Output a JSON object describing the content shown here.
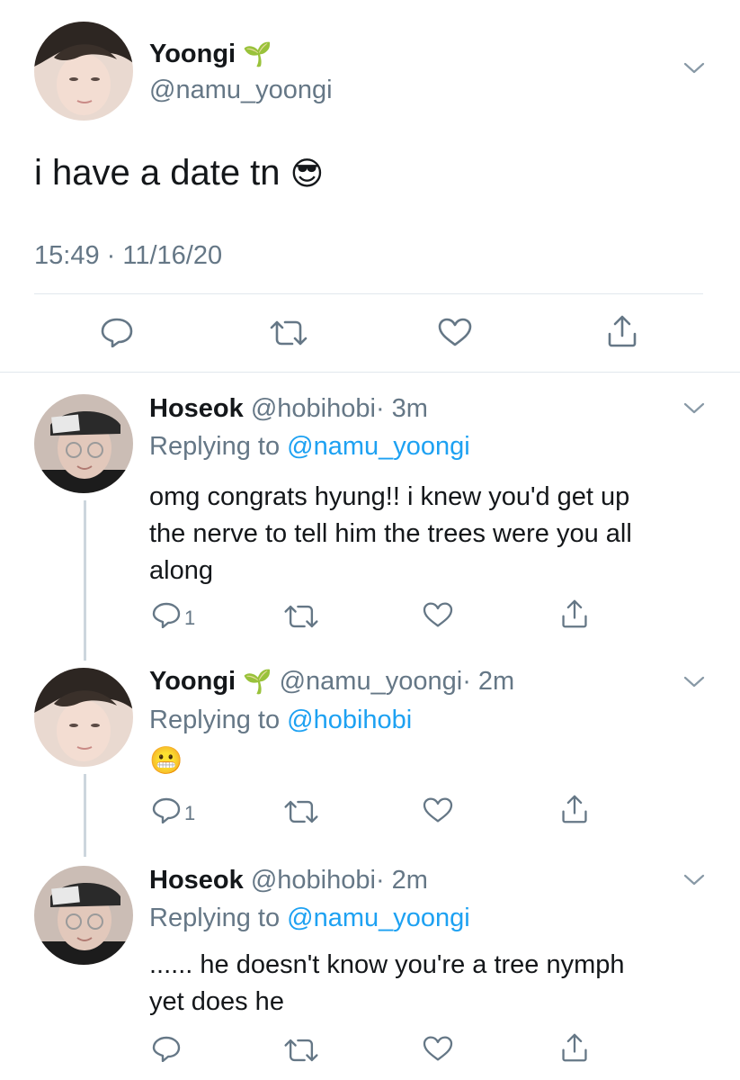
{
  "main_tweet": {
    "name": "Yoongi",
    "name_emoji": "🌱",
    "handle": "@namu_yoongi",
    "text": "i have a date tn",
    "text_emoji": "😎",
    "timestamp": "15:49 · 11/16/20",
    "actions": [
      "reply-icon",
      "retweet-icon",
      "like-icon",
      "share-icon"
    ]
  },
  "replies": [
    {
      "name": "Hoseok",
      "handle": "@hobihobi",
      "time": "· 3m",
      "replying_prefix": "Replying to",
      "replying_to": "@namu_yoongi",
      "text_lines": [
        "omg congrats hyung!! i knew you'd get up",
        "the nerve to tell him the trees were you all",
        "along"
      ],
      "reply_count": "1"
    },
    {
      "name": "Yoongi",
      "name_emoji": "🌱",
      "handle": "@namu_yoongi",
      "time": "· 2m",
      "replying_prefix": "Replying to",
      "replying_to": "@hobihobi",
      "text_emoji": "😬",
      "reply_count": "1"
    },
    {
      "name": "Hoseok",
      "handle": "@hobihobi",
      "time": "· 2m",
      "replying_prefix": "Replying to",
      "replying_to": "@namu_yoongi",
      "text_lines": [
        "...... he doesn't know you're a tree nymph",
        "yet does he"
      ],
      "reply_count": ""
    }
  ],
  "colors": {
    "text": "#14171a",
    "muted": "#657786",
    "link": "#1da1f2",
    "divider": "#e1e8ed",
    "thread_line": "#ccd6dd"
  }
}
